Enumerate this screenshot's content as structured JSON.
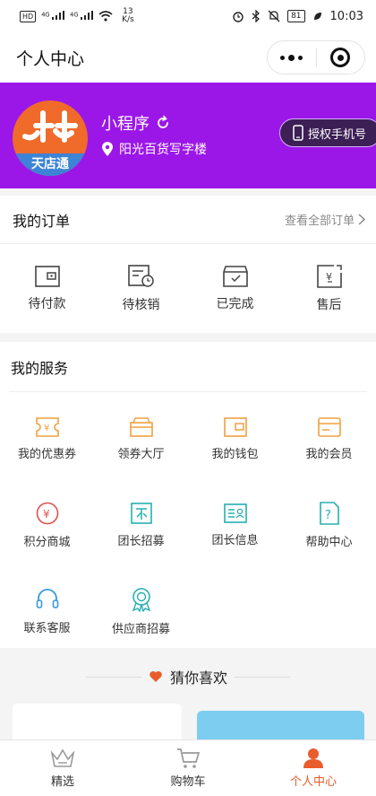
{
  "status_bar": {
    "network_badge": "HD",
    "signal_1": "4G",
    "signal_2": "4G",
    "speed_value": "13",
    "speed_unit": "K/s",
    "battery": "81",
    "time": "10:03"
  },
  "header": {
    "title": "个人中心"
  },
  "profile": {
    "name": "小程序",
    "location": "阳光百货写字楼",
    "auth_button": "授权手机号",
    "avatar_text": "天店通"
  },
  "orders": {
    "title": "我的订单",
    "see_all": "查看全部订单",
    "items": [
      {
        "label": "待付款",
        "icon": "wallet-icon"
      },
      {
        "label": "待核销",
        "icon": "pending-verify-icon"
      },
      {
        "label": "已完成",
        "icon": "completed-box-icon"
      },
      {
        "label": "售后",
        "icon": "after-sales-icon"
      }
    ]
  },
  "services": {
    "title": "我的服务",
    "items": [
      {
        "label": "我的优惠券",
        "icon": "coupon-icon",
        "color": "#f0a040"
      },
      {
        "label": "领券大厅",
        "icon": "coupon-hall-icon",
        "color": "#f0a040"
      },
      {
        "label": "我的钱包",
        "icon": "wallet-icon",
        "color": "#f0a040"
      },
      {
        "label": "我的会员",
        "icon": "membership-card-icon",
        "color": "#f0a040"
      },
      {
        "label": "积分商城",
        "icon": "points-mall-icon",
        "color": "#e05050"
      },
      {
        "label": "团长招募",
        "icon": "leader-recruit-icon",
        "color": "#26b0b0"
      },
      {
        "label": "团长信息",
        "icon": "leader-info-icon",
        "color": "#26b0b0"
      },
      {
        "label": "帮助中心",
        "icon": "help-icon",
        "color": "#26b0b0"
      },
      {
        "label": "联系客服",
        "icon": "headset-icon",
        "color": "#3a9ad9"
      },
      {
        "label": "供应商招募",
        "icon": "supplier-badge-icon",
        "color": "#26b0b0"
      }
    ]
  },
  "guess": {
    "title": "猜你喜欢"
  },
  "tabbar": {
    "tabs": [
      {
        "label": "精选",
        "icon": "crown-icon"
      },
      {
        "label": "购物车",
        "icon": "cart-icon"
      },
      {
        "label": "个人中心",
        "icon": "person-icon"
      }
    ]
  },
  "colors": {
    "brand_purple": "#9b17e8",
    "auth_button_bg": "#3c1f55",
    "active_tab": "#e95c2b",
    "guess_heart": "#e95c2b"
  }
}
